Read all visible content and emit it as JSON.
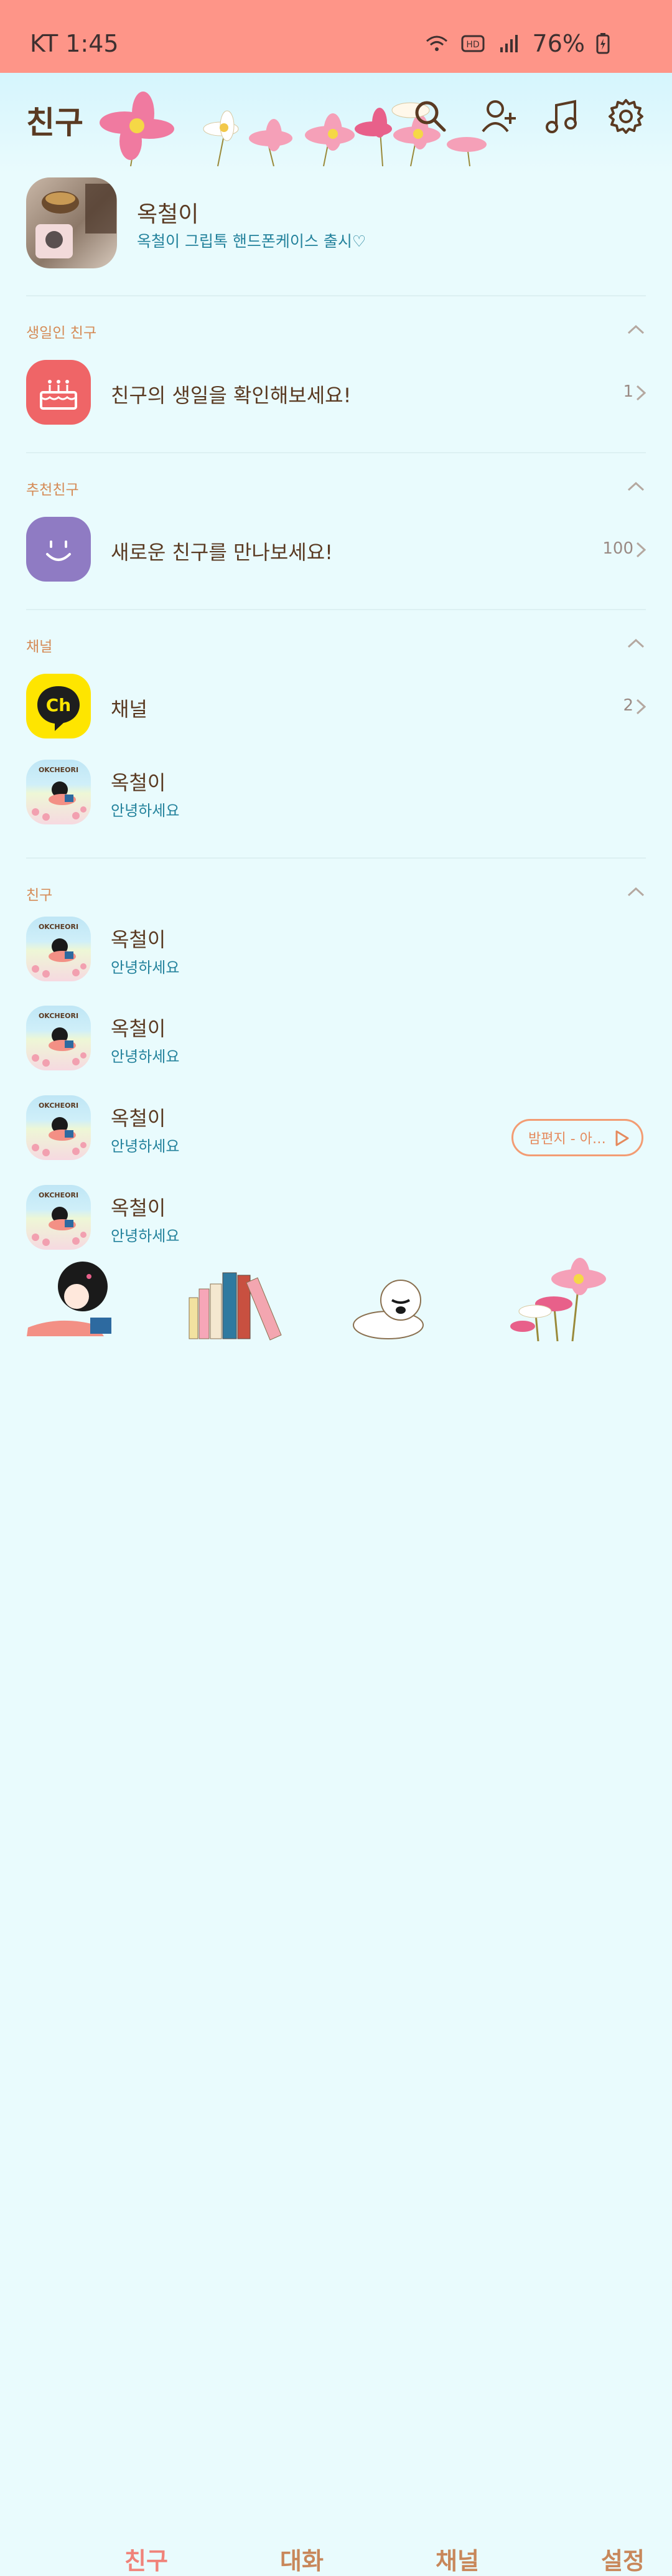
{
  "status_bar": {
    "carrier_time": "KT 1:45",
    "battery": "76%"
  },
  "header": {
    "title": "친구"
  },
  "profile": {
    "name": "옥철이",
    "status": "옥철이 그립톡 핸드폰케이스 출시♡"
  },
  "sections": {
    "birthday": {
      "title": "생일인 친구",
      "row_title": "친구의 생일을 확인해보세요!",
      "count": "1"
    },
    "recommended": {
      "title": "추천친구",
      "row_title": "새로운 친구를 만나보세요!",
      "count": "100"
    },
    "channel": {
      "title": "채널",
      "row_title": "채널",
      "count": "2",
      "channel_icon_text": "Ch",
      "item": {
        "name": "옥철이",
        "status": "안녕하세요",
        "avatar_text": "OKCHEORI"
      }
    },
    "friends": {
      "title": "친구",
      "items": [
        {
          "name": "옥철이",
          "status": "안녕하세요",
          "avatar_text": "OKCHEORI"
        },
        {
          "name": "옥철이",
          "status": "안녕하세요",
          "avatar_text": "OKCHEORI"
        },
        {
          "name": "옥철이",
          "status": "안녕하세요",
          "avatar_text": "OKCHEORI"
        },
        {
          "name": "옥철이",
          "status": "안녕하세요",
          "avatar_text": "OKCHEORI"
        }
      ]
    }
  },
  "music_pill": {
    "label": "밤편지 - 아…"
  },
  "bottom_nav": [
    {
      "label": "친구",
      "color": "#f0837a"
    },
    {
      "label": "대화",
      "color": "#c8875a"
    },
    {
      "label": "채널",
      "color": "#c8875a"
    },
    {
      "label": "설정",
      "color": "#c8875a"
    }
  ],
  "colors": {
    "status_bar": "#fe9588",
    "background": "#e9fbfd",
    "accent_text": "#23829c",
    "section_head": "#d58a55"
  }
}
